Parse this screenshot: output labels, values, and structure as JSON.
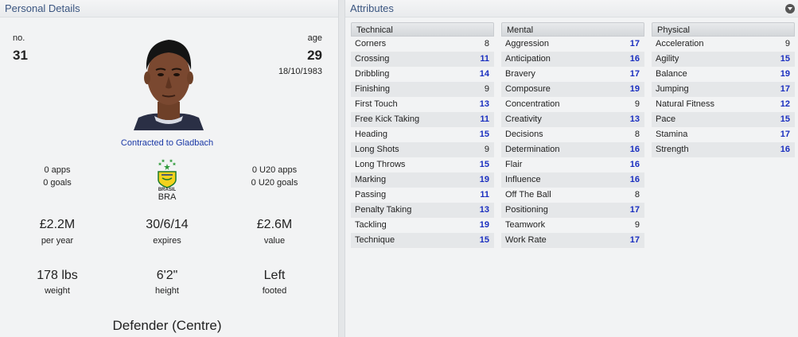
{
  "personal": {
    "header": "Personal Details",
    "no_label": "no.",
    "no_value": "31",
    "age_label": "age",
    "age_value": "29",
    "dob": "18/10/1983",
    "contract": "Contracted to Gladbach",
    "apps": "0 apps",
    "goals": "0 goals",
    "u20_apps": "0 U20 apps",
    "u20_goals": "0 U20 goals",
    "nation_badge_text": "BRASIL",
    "nation": "BRA",
    "wage": "£2.2M",
    "wage_caption": "per year",
    "expires": "30/6/14",
    "expires_caption": "expires",
    "value": "£2.6M",
    "value_caption": "value",
    "weight": "178 lbs",
    "weight_caption": "weight",
    "height": "6'2\"",
    "height_caption": "height",
    "foot": "Left",
    "foot_caption": "footed",
    "position": "Defender (Centre)"
  },
  "attributes": {
    "header": "Attributes",
    "highlight_color": "#1a2fc0",
    "columns": [
      {
        "title": "Technical",
        "rows": [
          {
            "name": "Corners",
            "value": "8",
            "hi": false
          },
          {
            "name": "Crossing",
            "value": "11",
            "hi": true
          },
          {
            "name": "Dribbling",
            "value": "14",
            "hi": true
          },
          {
            "name": "Finishing",
            "value": "9",
            "hi": false
          },
          {
            "name": "First Touch",
            "value": "13",
            "hi": true
          },
          {
            "name": "Free Kick Taking",
            "value": "11",
            "hi": true
          },
          {
            "name": "Heading",
            "value": "15",
            "hi": true
          },
          {
            "name": "Long Shots",
            "value": "9",
            "hi": false
          },
          {
            "name": "Long Throws",
            "value": "15",
            "hi": true
          },
          {
            "name": "Marking",
            "value": "19",
            "hi": true
          },
          {
            "name": "Passing",
            "value": "11",
            "hi": true
          },
          {
            "name": "Penalty Taking",
            "value": "13",
            "hi": true
          },
          {
            "name": "Tackling",
            "value": "19",
            "hi": true
          },
          {
            "name": "Technique",
            "value": "15",
            "hi": true
          }
        ]
      },
      {
        "title": "Mental",
        "rows": [
          {
            "name": "Aggression",
            "value": "17",
            "hi": true
          },
          {
            "name": "Anticipation",
            "value": "16",
            "hi": true
          },
          {
            "name": "Bravery",
            "value": "17",
            "hi": true
          },
          {
            "name": "Composure",
            "value": "19",
            "hi": true
          },
          {
            "name": "Concentration",
            "value": "9",
            "hi": false
          },
          {
            "name": "Creativity",
            "value": "13",
            "hi": true
          },
          {
            "name": "Decisions",
            "value": "8",
            "hi": false
          },
          {
            "name": "Determination",
            "value": "16",
            "hi": true
          },
          {
            "name": "Flair",
            "value": "16",
            "hi": true
          },
          {
            "name": "Influence",
            "value": "16",
            "hi": true
          },
          {
            "name": "Off The Ball",
            "value": "8",
            "hi": false
          },
          {
            "name": "Positioning",
            "value": "17",
            "hi": true
          },
          {
            "name": "Teamwork",
            "value": "9",
            "hi": false
          },
          {
            "name": "Work Rate",
            "value": "17",
            "hi": true
          }
        ]
      },
      {
        "title": "Physical",
        "rows": [
          {
            "name": "Acceleration",
            "value": "9",
            "hi": false
          },
          {
            "name": "Agility",
            "value": "15",
            "hi": true
          },
          {
            "name": "Balance",
            "value": "19",
            "hi": true
          },
          {
            "name": "Jumping",
            "value": "17",
            "hi": true
          },
          {
            "name": "Natural Fitness",
            "value": "12",
            "hi": true
          },
          {
            "name": "Pace",
            "value": "15",
            "hi": true
          },
          {
            "name": "Stamina",
            "value": "17",
            "hi": true
          },
          {
            "name": "Strength",
            "value": "16",
            "hi": true
          }
        ]
      }
    ]
  }
}
